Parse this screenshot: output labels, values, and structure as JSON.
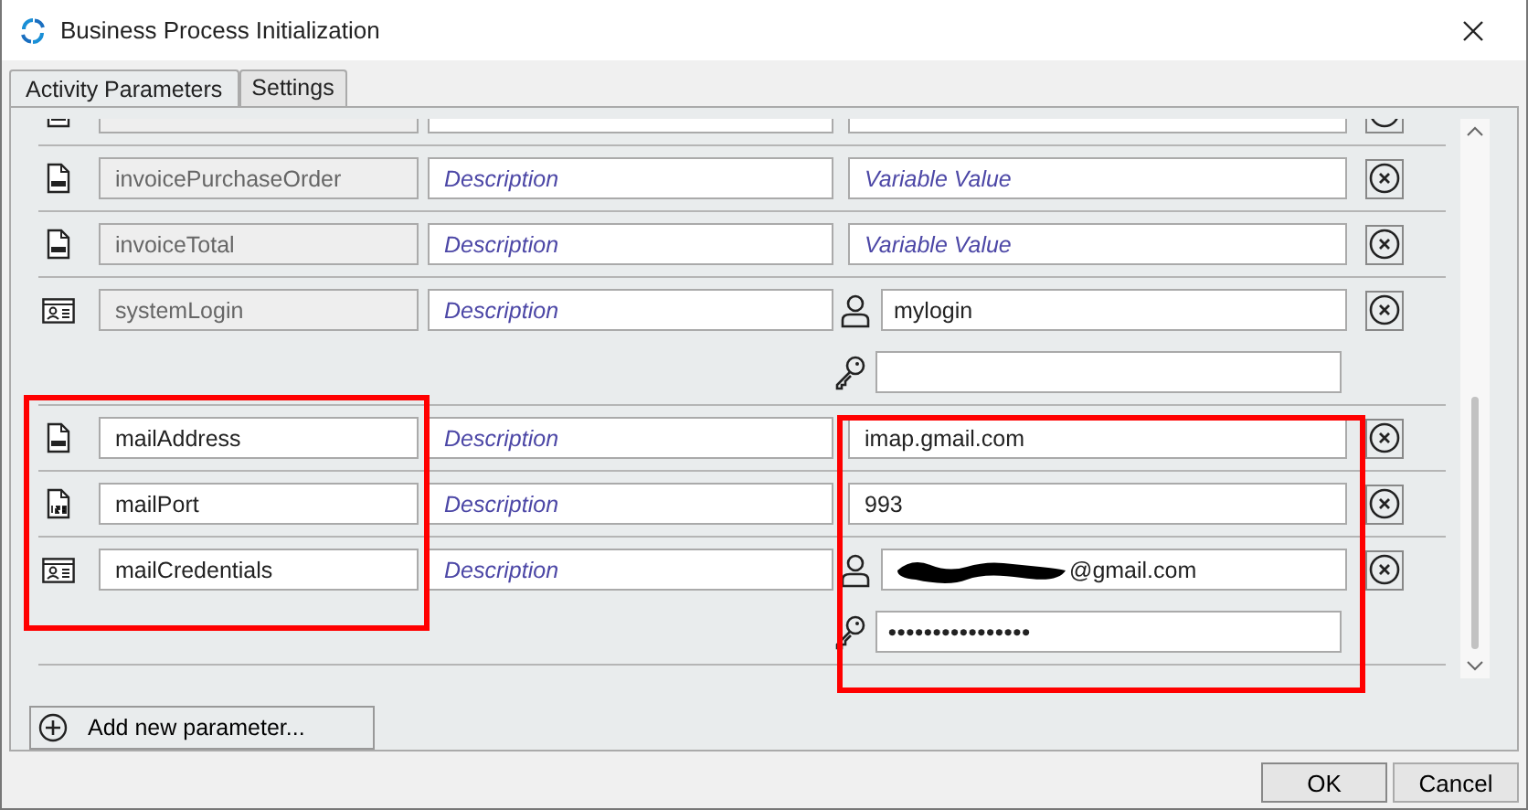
{
  "window": {
    "title": "Business Process Initialization"
  },
  "tabs": [
    {
      "label": "Activity Parameters",
      "selected": true
    },
    {
      "label": "Settings",
      "selected": false
    }
  ],
  "parameters": [
    {
      "kind": "string",
      "name_editable": false
    },
    {
      "kind": "string",
      "name": "invoicePurchaseOrder",
      "name_editable": false,
      "description_placeholder": "Description",
      "value_placeholder": "Variable Value"
    },
    {
      "kind": "string",
      "name": "invoiceTotal",
      "name_editable": false,
      "description_placeholder": "Description",
      "value_placeholder": "Variable Value"
    },
    {
      "kind": "credential",
      "name": "systemLogin",
      "name_editable": false,
      "description_placeholder": "Description",
      "username": "mylogin"
    },
    {
      "kind": "string",
      "name": "mailAddress",
      "name_editable": true,
      "description_placeholder": "Description",
      "value": "imap.gmail.com"
    },
    {
      "kind": "number",
      "name": "mailPort",
      "name_editable": true,
      "description_placeholder": "Description",
      "value": "993"
    },
    {
      "kind": "credential",
      "name": "mailCredentials",
      "name_editable": true,
      "description_placeholder": "Description",
      "username": "@gmail.com",
      "username_redacted": true,
      "password": "••••••••••••••••"
    }
  ],
  "add_button": {
    "label": "Add new parameter..."
  },
  "buttons": [
    {
      "label": "OK",
      "kind": "default"
    },
    {
      "label": "Cancel",
      "kind": "normal"
    }
  ],
  "highlight_frames": {
    "names_column": true,
    "values_column": true
  }
}
